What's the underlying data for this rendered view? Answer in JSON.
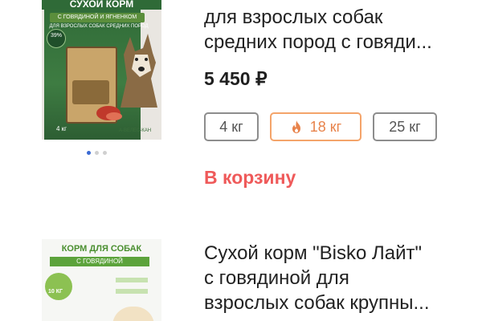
{
  "products": [
    {
      "image": {
        "package_title": "СУХОЙ КОРМ",
        "package_subtitle": "С ГОВЯДИНОЙ И ЯГНЕНКОМ",
        "package_desc": "ДЛЯ ВЗРОСЛЫХ СОБАК СРЕДНИХ ПОРОД",
        "badge": "39%",
        "weight": "4 кг",
        "brand": "А-ВЕЛЕС-КАН"
      },
      "title_line1": "для взрослых собак",
      "title_line2": "средних пород с говяди...",
      "price": "5 450 ₽",
      "sizes": [
        "4 кг",
        "18 кг",
        "25 кг"
      ],
      "cart_label": "В корзину",
      "carousel": {
        "count": 3,
        "active": 1
      }
    },
    {
      "image": {
        "package_title": "КОРМ ДЛЯ СОБАК",
        "package_subtitle": "С ГОВЯДИНОЙ",
        "weight": "10 КГ"
      },
      "title_line1": "Сухой корм \"Bisko Лайт\"",
      "title_line2": "с говядиной для",
      "title_line3": "взрослых собак крупны..."
    }
  ],
  "colors": {
    "accent_red": "#ef5a5a",
    "chip_selected": "#e8834b",
    "chip_border": "#8d8d8d",
    "carousel_active": "#3a6ad4"
  },
  "icons": {
    "selected_size": "fire-icon"
  }
}
